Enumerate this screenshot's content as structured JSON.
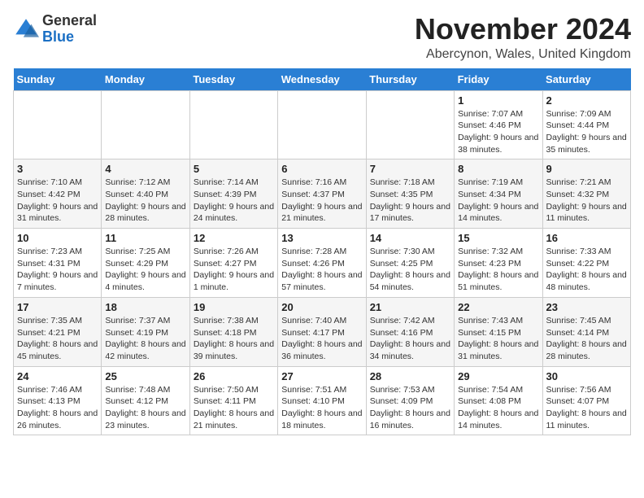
{
  "logo": {
    "general": "General",
    "blue": "Blue"
  },
  "header": {
    "month": "November 2024",
    "location": "Abercynon, Wales, United Kingdom"
  },
  "days_of_week": [
    "Sunday",
    "Monday",
    "Tuesday",
    "Wednesday",
    "Thursday",
    "Friday",
    "Saturday"
  ],
  "weeks": [
    [
      {
        "day": "",
        "info": ""
      },
      {
        "day": "",
        "info": ""
      },
      {
        "day": "",
        "info": ""
      },
      {
        "day": "",
        "info": ""
      },
      {
        "day": "",
        "info": ""
      },
      {
        "day": "1",
        "info": "Sunrise: 7:07 AM\nSunset: 4:46 PM\nDaylight: 9 hours and 38 minutes."
      },
      {
        "day": "2",
        "info": "Sunrise: 7:09 AM\nSunset: 4:44 PM\nDaylight: 9 hours and 35 minutes."
      }
    ],
    [
      {
        "day": "3",
        "info": "Sunrise: 7:10 AM\nSunset: 4:42 PM\nDaylight: 9 hours and 31 minutes."
      },
      {
        "day": "4",
        "info": "Sunrise: 7:12 AM\nSunset: 4:40 PM\nDaylight: 9 hours and 28 minutes."
      },
      {
        "day": "5",
        "info": "Sunrise: 7:14 AM\nSunset: 4:39 PM\nDaylight: 9 hours and 24 minutes."
      },
      {
        "day": "6",
        "info": "Sunrise: 7:16 AM\nSunset: 4:37 PM\nDaylight: 9 hours and 21 minutes."
      },
      {
        "day": "7",
        "info": "Sunrise: 7:18 AM\nSunset: 4:35 PM\nDaylight: 9 hours and 17 minutes."
      },
      {
        "day": "8",
        "info": "Sunrise: 7:19 AM\nSunset: 4:34 PM\nDaylight: 9 hours and 14 minutes."
      },
      {
        "day": "9",
        "info": "Sunrise: 7:21 AM\nSunset: 4:32 PM\nDaylight: 9 hours and 11 minutes."
      }
    ],
    [
      {
        "day": "10",
        "info": "Sunrise: 7:23 AM\nSunset: 4:31 PM\nDaylight: 9 hours and 7 minutes."
      },
      {
        "day": "11",
        "info": "Sunrise: 7:25 AM\nSunset: 4:29 PM\nDaylight: 9 hours and 4 minutes."
      },
      {
        "day": "12",
        "info": "Sunrise: 7:26 AM\nSunset: 4:27 PM\nDaylight: 9 hours and 1 minute."
      },
      {
        "day": "13",
        "info": "Sunrise: 7:28 AM\nSunset: 4:26 PM\nDaylight: 8 hours and 57 minutes."
      },
      {
        "day": "14",
        "info": "Sunrise: 7:30 AM\nSunset: 4:25 PM\nDaylight: 8 hours and 54 minutes."
      },
      {
        "day": "15",
        "info": "Sunrise: 7:32 AM\nSunset: 4:23 PM\nDaylight: 8 hours and 51 minutes."
      },
      {
        "day": "16",
        "info": "Sunrise: 7:33 AM\nSunset: 4:22 PM\nDaylight: 8 hours and 48 minutes."
      }
    ],
    [
      {
        "day": "17",
        "info": "Sunrise: 7:35 AM\nSunset: 4:21 PM\nDaylight: 8 hours and 45 minutes."
      },
      {
        "day": "18",
        "info": "Sunrise: 7:37 AM\nSunset: 4:19 PM\nDaylight: 8 hours and 42 minutes."
      },
      {
        "day": "19",
        "info": "Sunrise: 7:38 AM\nSunset: 4:18 PM\nDaylight: 8 hours and 39 minutes."
      },
      {
        "day": "20",
        "info": "Sunrise: 7:40 AM\nSunset: 4:17 PM\nDaylight: 8 hours and 36 minutes."
      },
      {
        "day": "21",
        "info": "Sunrise: 7:42 AM\nSunset: 4:16 PM\nDaylight: 8 hours and 34 minutes."
      },
      {
        "day": "22",
        "info": "Sunrise: 7:43 AM\nSunset: 4:15 PM\nDaylight: 8 hours and 31 minutes."
      },
      {
        "day": "23",
        "info": "Sunrise: 7:45 AM\nSunset: 4:14 PM\nDaylight: 8 hours and 28 minutes."
      }
    ],
    [
      {
        "day": "24",
        "info": "Sunrise: 7:46 AM\nSunset: 4:13 PM\nDaylight: 8 hours and 26 minutes."
      },
      {
        "day": "25",
        "info": "Sunrise: 7:48 AM\nSunset: 4:12 PM\nDaylight: 8 hours and 23 minutes."
      },
      {
        "day": "26",
        "info": "Sunrise: 7:50 AM\nSunset: 4:11 PM\nDaylight: 8 hours and 21 minutes."
      },
      {
        "day": "27",
        "info": "Sunrise: 7:51 AM\nSunset: 4:10 PM\nDaylight: 8 hours and 18 minutes."
      },
      {
        "day": "28",
        "info": "Sunrise: 7:53 AM\nSunset: 4:09 PM\nDaylight: 8 hours and 16 minutes."
      },
      {
        "day": "29",
        "info": "Sunrise: 7:54 AM\nSunset: 4:08 PM\nDaylight: 8 hours and 14 minutes."
      },
      {
        "day": "30",
        "info": "Sunrise: 7:56 AM\nSunset: 4:07 PM\nDaylight: 8 hours and 11 minutes."
      }
    ]
  ]
}
